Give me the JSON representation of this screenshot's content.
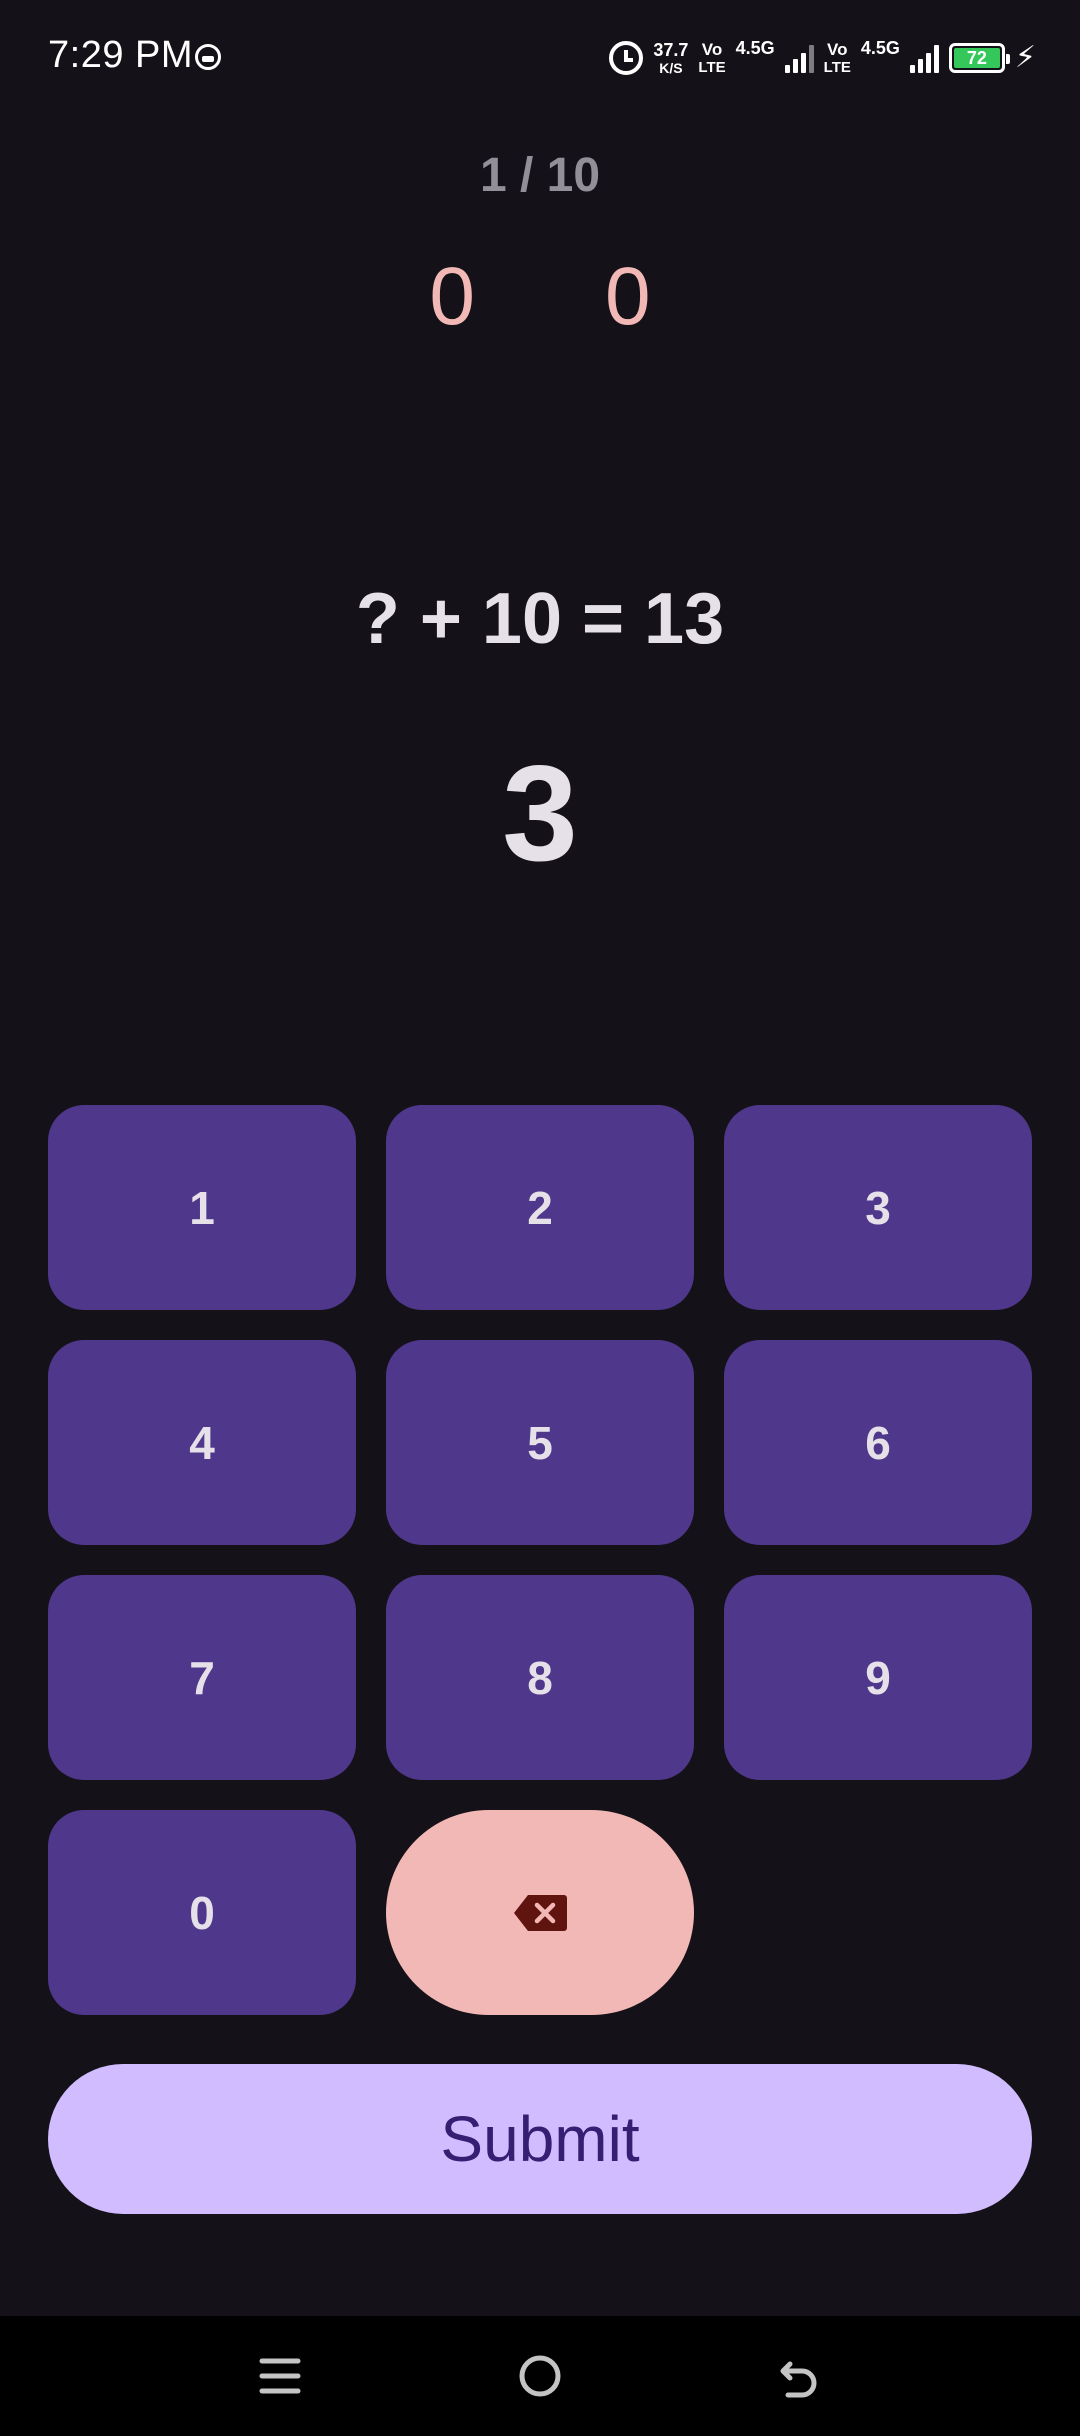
{
  "status_bar": {
    "time": "7:29 PM",
    "net_speed_value": "37.7",
    "net_speed_unit": "K/S",
    "sim1_volte_top": "Vo",
    "sim1_volte_bottom": "LTE",
    "sim1_network": "4.5G",
    "sim2_volte_top": "Vo",
    "sim2_volte_bottom": "LTE",
    "sim2_network": "4.5G",
    "battery_level": "72",
    "icons": [
      "app-notification-icon",
      "alarm-icon",
      "signal-icon",
      "battery-icon",
      "charging-icon"
    ]
  },
  "game": {
    "progress": "1 / 10",
    "score_left": "0",
    "score_right": "0",
    "equation": "? + 10 = 13",
    "answer": "3"
  },
  "keypad": {
    "keys": [
      "1",
      "2",
      "3",
      "4",
      "5",
      "6",
      "7",
      "8",
      "9",
      "0"
    ],
    "backspace_icon": "backspace-icon"
  },
  "submit_label": "Submit",
  "nav_bar": {
    "icons": [
      "menu-icon",
      "home-icon",
      "back-icon"
    ]
  },
  "colors": {
    "background": "#141218",
    "key": "#4F378B",
    "backspace": "#F2B8B5",
    "submit": "#D0BCFF",
    "submit_text": "#381E72",
    "score": "#F2B8B5",
    "progress": "#938F99"
  }
}
